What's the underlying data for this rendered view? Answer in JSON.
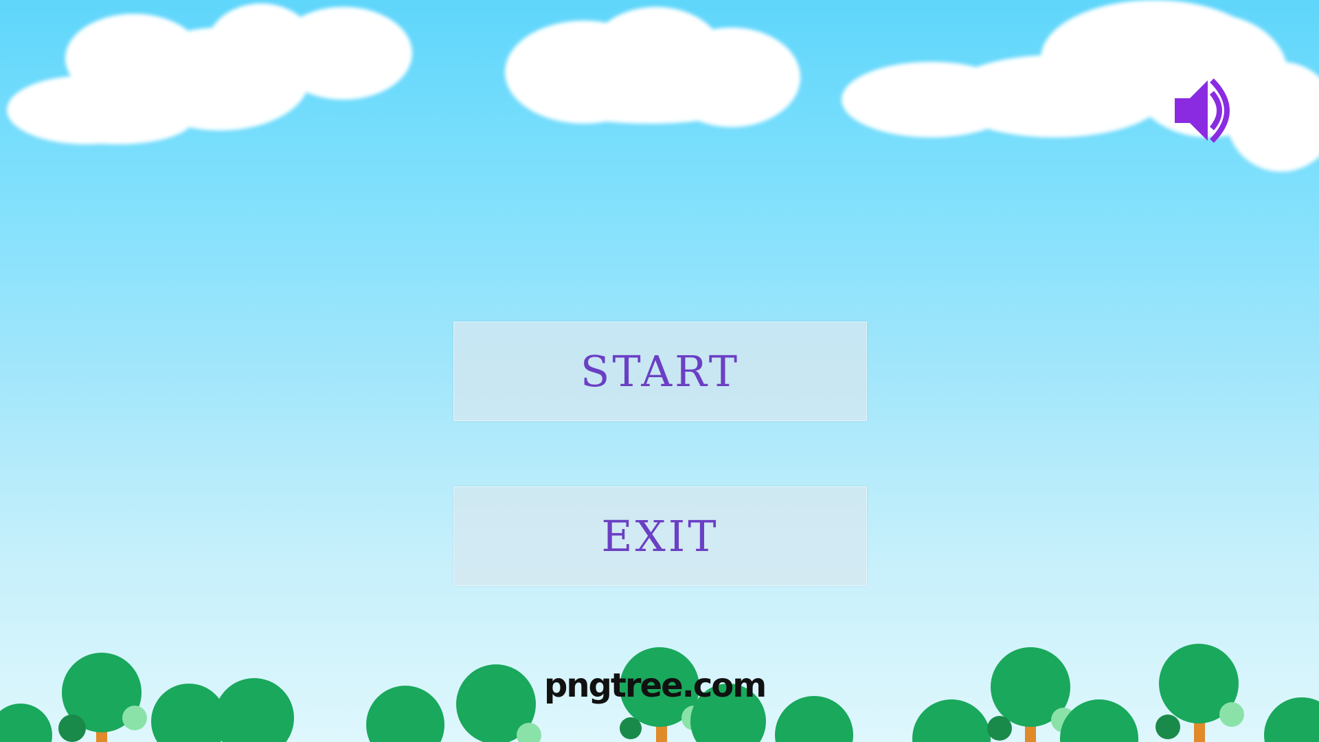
{
  "menu": {
    "start_label": "START",
    "exit_label": "EXIT"
  },
  "sound": {
    "icon": "speaker-volume-icon",
    "state": "on"
  },
  "watermark": {
    "text": "pngtree.com"
  },
  "colors": {
    "sky_top": "#5fd6fb",
    "sky_bottom": "#dff7fd",
    "button_text": "#6b3fc4",
    "button_bg": "#d7e8f0",
    "sound_icon": "#8a2be2",
    "tree_foliage": "#1aa85c",
    "tree_trunk": "#e08a2a"
  }
}
